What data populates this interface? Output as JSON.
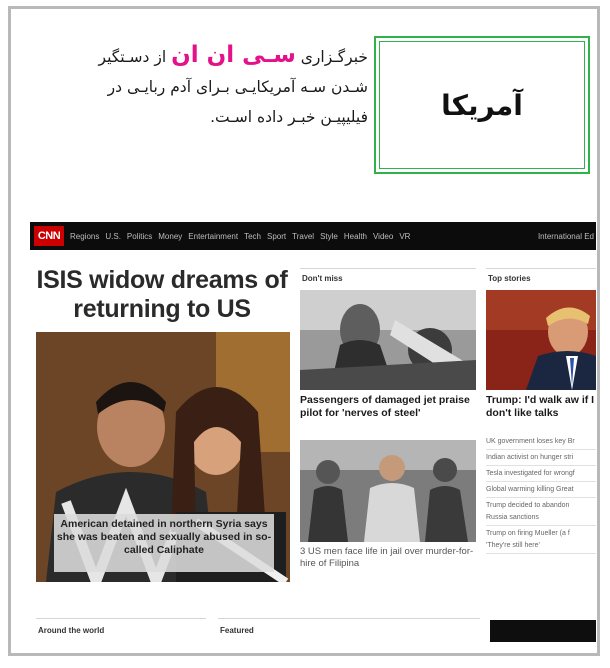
{
  "colors": {
    "frame_border": "#b9b9b9",
    "label_border": "#2fb24a",
    "brand_pink": "#e4128a",
    "cnn_red": "#cc0000",
    "cnn_bar": "#0c0c0c"
  },
  "label_box": {
    "text": "آمریکا"
  },
  "caption": {
    "line1_before": "خبرگـزاری ",
    "brand": "سـی ان ان",
    "line1_after": " از دسـتگیر",
    "line2": "شـدن سـه آمریکایـی بـرای آدم ربایـی در",
    "line3": "فیلیپیـن خبـر داده اسـت."
  },
  "cnn": {
    "logo": "CNN",
    "nav": [
      "Regions",
      "U.S.",
      "Politics",
      "Money",
      "Entertainment",
      "Tech",
      "Sport",
      "Travel",
      "Style",
      "Health",
      "Video",
      "VR"
    ],
    "nav_right": "International Ed",
    "lead_title": "ISIS widow dreams of returning to US",
    "lead_caption": "American detained in northern Syria says she was beaten and sexually abused in so-called Caliphate",
    "dont_miss_label": "Don't miss",
    "top_stories_label": "Top stories",
    "story1_headline": "Passengers of damaged jet praise pilot for 'nerves of steel'",
    "story2_headline": "3 US men face life in jail over murder-for-hire of Filipina",
    "top_headline": "Trump: I'd walk aw if I don't like talks",
    "top_list": [
      "UK government loses key Br",
      "Indian activist on hunger stri",
      "Tesla investigated for wrongf",
      "Global warming killing Great",
      "Trump decided to abandon",
      "Russia sanctions",
      "Trump on firing Mueller (a f",
      "'They're still here'"
    ],
    "around_label": "Around the world",
    "featured_label": "Featured"
  }
}
